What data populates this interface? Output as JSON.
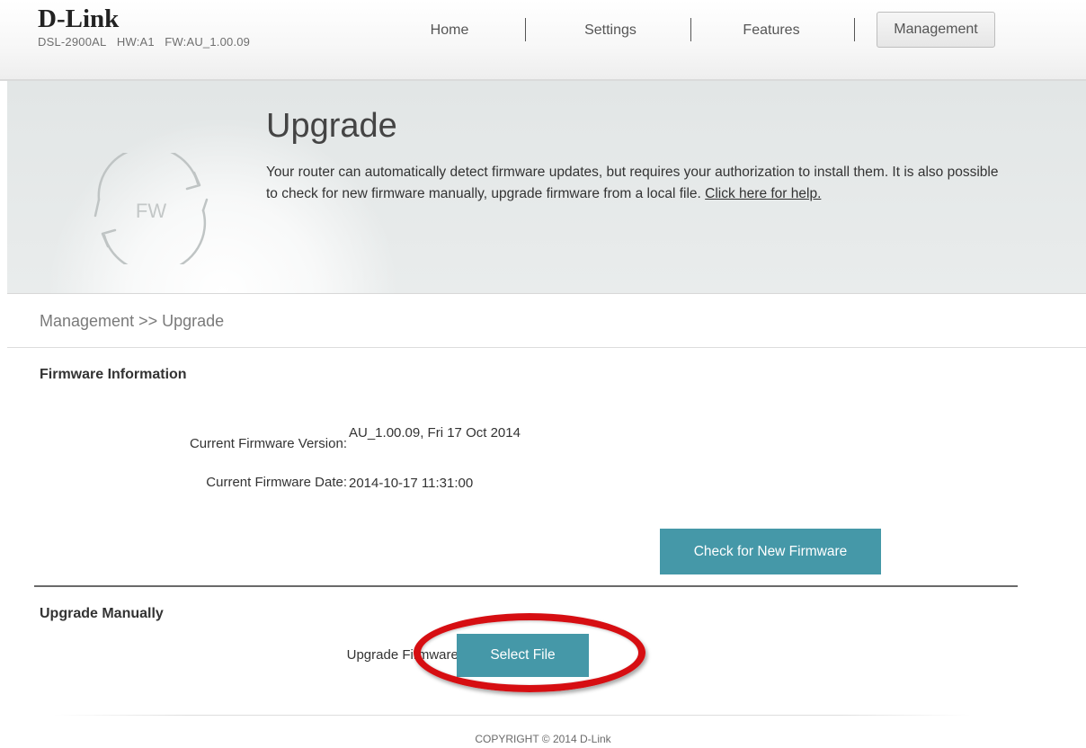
{
  "header": {
    "logo": "D-Link",
    "model": "DSL-2900AL",
    "hw": "HW:A1",
    "fw": "FW:AU_1.00.09",
    "nav": {
      "home": "Home",
      "settings": "Settings",
      "features": "Features",
      "management": "Management"
    },
    "active_nav": "Management"
  },
  "banner": {
    "icon_label": "FW",
    "title": "Upgrade",
    "description": "Your router can automatically detect firmware updates, but requires your authorization to install them. It is also possible to check for new firmware manually, upgrade firmware from a local file. ",
    "help_link": "Click here for help."
  },
  "breadcrumb": "Management >> Upgrade",
  "firmware_info": {
    "title": "Firmware Information",
    "version_label": "Current Firmware Version:",
    "version_value": "AU_1.00.09, Fri 17 Oct 2014",
    "date_label": "Current Firmware Date:",
    "date_value": "2014-10-17 11:31:00",
    "check_button": "Check for New Firmware"
  },
  "upgrade_manually": {
    "title": "Upgrade Manually",
    "label": "Upgrade Firmware:",
    "select_button": "Select File"
  },
  "footer": {
    "copyright": "COPYRIGHT © 2014 D-Link"
  },
  "colors": {
    "accent_button": "#4598a8",
    "highlight_ring": "#d60e12"
  }
}
